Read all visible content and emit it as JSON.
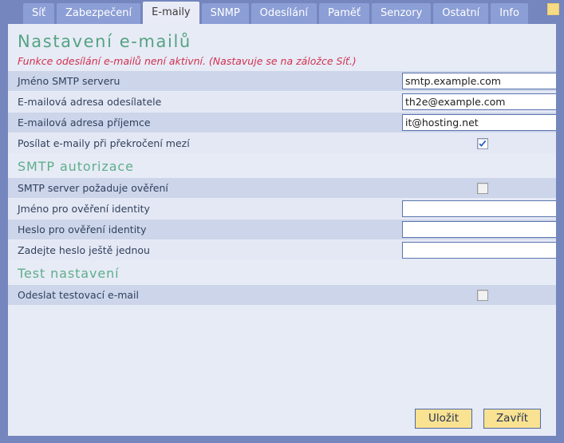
{
  "window": {
    "accent_blue": "#7486bd",
    "panel_bg": "#e7ebf6",
    "title_green": "#54a382",
    "warning_red": "#d1304f",
    "button_yellow": "#f9e291"
  },
  "tabs": [
    {
      "label": "Síť",
      "active": false
    },
    {
      "label": "Zabezpečení",
      "active": false
    },
    {
      "label": "E-maily",
      "active": true
    },
    {
      "label": "SNMP",
      "active": false
    },
    {
      "label": "Odesílání",
      "active": false
    },
    {
      "label": "Paměť",
      "active": false
    },
    {
      "label": "Senzory",
      "active": false
    },
    {
      "label": "Ostatní",
      "active": false
    },
    {
      "label": "Info",
      "active": false
    }
  ],
  "page": {
    "title": "Nastavení e-mailů",
    "warning": "Funkce odesílání e-mailů není aktivní. (Nastavuje se na záložce Síť.)"
  },
  "sections": [
    {
      "heading": null,
      "rows": [
        {
          "type": "text",
          "label": "Jméno SMTP serveru",
          "value": "smtp.example.com",
          "placeholder": ""
        },
        {
          "type": "text",
          "label": "E-mailová adresa odesílatele",
          "value": "th2e@example.com",
          "placeholder": ""
        },
        {
          "type": "text",
          "label": "E-mailová adresa příjemce",
          "value": "it@hosting.net",
          "placeholder": ""
        },
        {
          "type": "checkbox",
          "label": "Posílat e-maily při překročení mezí",
          "checked": true,
          "disabled": false
        }
      ]
    },
    {
      "heading": "SMTP autorizace",
      "rows": [
        {
          "type": "checkbox",
          "label": "SMTP server požaduje ověření",
          "checked": false,
          "disabled": true
        },
        {
          "type": "text",
          "label": "Jméno pro ověření identity",
          "value": "",
          "placeholder": ""
        },
        {
          "type": "text",
          "label": "Heslo pro ověření identity",
          "value": "",
          "placeholder": ""
        },
        {
          "type": "text",
          "label": "Zadejte heslo ještě jednou",
          "value": "",
          "placeholder": ""
        }
      ]
    },
    {
      "heading": "Test nastavení",
      "rows": [
        {
          "type": "checkbox",
          "label": "Odeslat testovací e-mail",
          "checked": false,
          "disabled": true
        }
      ]
    }
  ],
  "footer": {
    "save_label": "Uložit",
    "close_label": "Zavřít"
  }
}
